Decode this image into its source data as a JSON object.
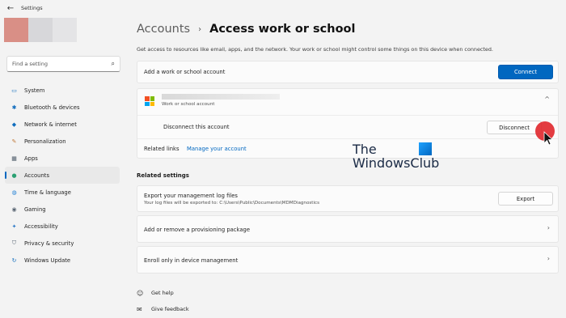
{
  "window": {
    "title": "Settings",
    "back_glyph": "←"
  },
  "search": {
    "placeholder": "Find a setting",
    "icon": "search-icon"
  },
  "sidebar": {
    "items": [
      {
        "label": "System",
        "icon": "system-icon",
        "glyph": "▭",
        "color": "#0f6cbd"
      },
      {
        "label": "Bluetooth & devices",
        "icon": "bluetooth-icon",
        "glyph": "✱",
        "color": "#0f6cbd"
      },
      {
        "label": "Network & internet",
        "icon": "wifi-icon",
        "glyph": "◆",
        "color": "#0f6cbd"
      },
      {
        "label": "Personalization",
        "icon": "brush-icon",
        "glyph": "✎",
        "color": "#c07a3a"
      },
      {
        "label": "Apps",
        "icon": "apps-icon",
        "glyph": "▦",
        "color": "#4a5866"
      },
      {
        "label": "Accounts",
        "icon": "person-icon",
        "glyph": "●",
        "color": "#2aa072"
      },
      {
        "label": "Time & language",
        "icon": "globe-icon",
        "glyph": "◍",
        "color": "#1f7fd4"
      },
      {
        "label": "Gaming",
        "icon": "gamepad-icon",
        "glyph": "◉",
        "color": "#5b6774"
      },
      {
        "label": "Accessibility",
        "icon": "accessibility-icon",
        "glyph": "✦",
        "color": "#2b78c6"
      },
      {
        "label": "Privacy & security",
        "icon": "shield-icon",
        "glyph": "⛉",
        "color": "#5b6774"
      },
      {
        "label": "Windows Update",
        "icon": "update-icon",
        "glyph": "↻",
        "color": "#0f6cbd"
      }
    ],
    "active_index": 5
  },
  "breadcrumb": {
    "parent": "Accounts",
    "separator": "›",
    "current": "Access work or school"
  },
  "description": "Get access to resources like email, apps, and the network. Your work or school might control some things on this device when connected.",
  "add_account": {
    "label": "Add a work or school account",
    "button": "Connect"
  },
  "work_account": {
    "subtitle": "Work or school account",
    "disconnect_label": "Disconnect this account",
    "disconnect_button": "Disconnect",
    "related_links_label": "Related links",
    "manage_link": "Manage your account",
    "collapse_glyph": "^"
  },
  "related_settings": {
    "heading": "Related settings",
    "export": {
      "title": "Export your management log files",
      "subtitle": "Your log files will be exported to: C:\\Users\\Public\\Documents\\MDMDiagnostics",
      "button": "Export"
    },
    "provisioning": {
      "label": "Add or remove a provisioning package"
    },
    "enroll": {
      "label": "Enroll only in device management"
    },
    "chevron_glyph": "›"
  },
  "footer_links": [
    {
      "label": "Get help",
      "icon": "help-icon",
      "glyph": "☺"
    },
    {
      "label": "Give feedback",
      "icon": "feedback-icon",
      "glyph": "✉"
    }
  ],
  "watermark": {
    "line1": "The",
    "line2": "WindowsClub"
  },
  "colors": {
    "accent": "#0067c0",
    "cursor_highlight": "#e0272c"
  }
}
